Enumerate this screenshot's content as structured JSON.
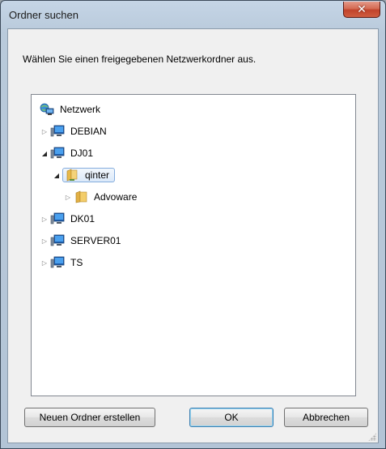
{
  "window": {
    "title": "Ordner suchen",
    "close_symbol": "✕"
  },
  "instruction": "Wählen Sie einen freigegebenen Netzwerkordner aus.",
  "tree": {
    "root": {
      "label": "Netzwerk",
      "icon": "network-icon"
    },
    "nodes": [
      {
        "label": "DEBIAN",
        "icon": "computer-icon",
        "expanded": false
      },
      {
        "label": "DJ01",
        "icon": "computer-icon",
        "expanded": true
      },
      {
        "label": "qinter",
        "icon": "shared-folder-icon",
        "expanded": true,
        "selected": true
      },
      {
        "label": "Advoware",
        "icon": "folder-icon",
        "expanded": false
      },
      {
        "label": "DK01",
        "icon": "computer-icon",
        "expanded": false
      },
      {
        "label": "SERVER01",
        "icon": "computer-icon",
        "expanded": false
      },
      {
        "label": "TS",
        "icon": "computer-icon",
        "expanded": false
      }
    ]
  },
  "buttons": {
    "new_folder": "Neuen Ordner erstellen",
    "ok": "OK",
    "cancel": "Abbrechen"
  },
  "colors": {
    "selection_border": "#84acdd",
    "close_button": "#c1432b",
    "window_frame": "#b9cadb"
  }
}
